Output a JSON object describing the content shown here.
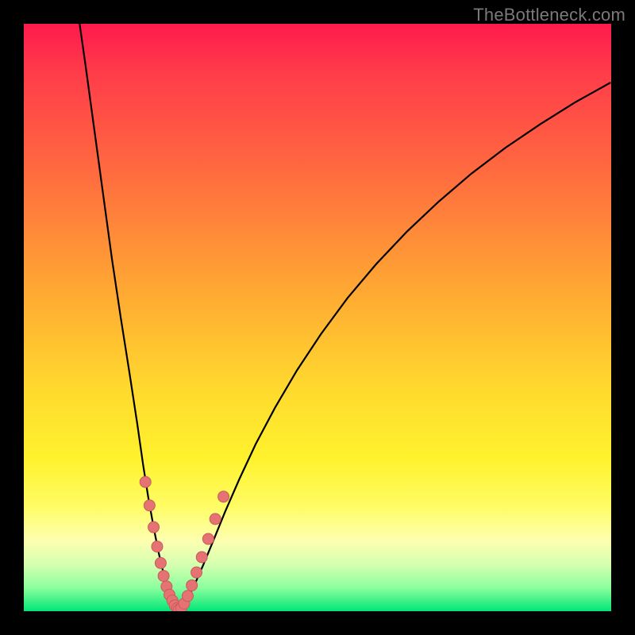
{
  "watermark": {
    "text": "TheBottleneck.com"
  },
  "colors": {
    "curve": "#000000",
    "dot_fill": "#e57373",
    "dot_stroke": "#cc5a5a",
    "background": "#000000"
  },
  "chart_data": {
    "type": "line",
    "title": "",
    "xlabel": "",
    "ylabel": "",
    "xlim": [
      0,
      100
    ],
    "ylim": [
      0,
      100
    ],
    "grid": false,
    "series": [
      {
        "name": "left-branch",
        "x": [
          9.5,
          10.5,
          12,
          13.5,
          15,
          16.5,
          18,
          19.3,
          20.3,
          21.2,
          22.1,
          22.9,
          23.7,
          24.4,
          25.1,
          25.8,
          26.4
        ],
        "y": [
          100,
          93,
          82,
          71,
          60,
          50,
          40.5,
          32,
          25,
          19.3,
          14.3,
          10.2,
          6.8,
          4.2,
          2.3,
          1.0,
          0.25
        ]
      },
      {
        "name": "right-branch",
        "x": [
          26.4,
          27.2,
          28.1,
          29.2,
          30.6,
          32.3,
          34.3,
          36.7,
          39.5,
          42.8,
          46.5,
          50.6,
          55.1,
          60,
          65.2,
          70.6,
          76.2,
          82,
          87.9,
          93.8,
          99.9
        ],
        "y": [
          0.25,
          1.0,
          2.5,
          4.8,
          8,
          12.1,
          17,
          22.5,
          28.5,
          34.7,
          41,
          47.2,
          53.3,
          59.1,
          64.6,
          69.7,
          74.5,
          78.9,
          82.9,
          86.6,
          90
        ]
      }
    ],
    "points": [
      {
        "name": "left-dots",
        "x": [
          20.7,
          21.4,
          22.1,
          22.7,
          23.3,
          23.8,
          24.3,
          24.8,
          25.3,
          25.7,
          26.1,
          26.4
        ],
        "y": [
          22,
          18,
          14.3,
          11,
          8.2,
          6,
          4.2,
          2.8,
          1.8,
          1.0,
          0.5,
          0.25
        ]
      },
      {
        "name": "right-dots",
        "x": [
          26.8,
          27.3,
          27.9,
          28.6,
          29.4,
          30.3,
          31.4,
          32.6,
          34.0
        ],
        "y": [
          0.5,
          1.3,
          2.6,
          4.4,
          6.6,
          9.2,
          12.3,
          15.7,
          19.5
        ]
      }
    ],
    "minimum_x_pct": 26.4
  }
}
